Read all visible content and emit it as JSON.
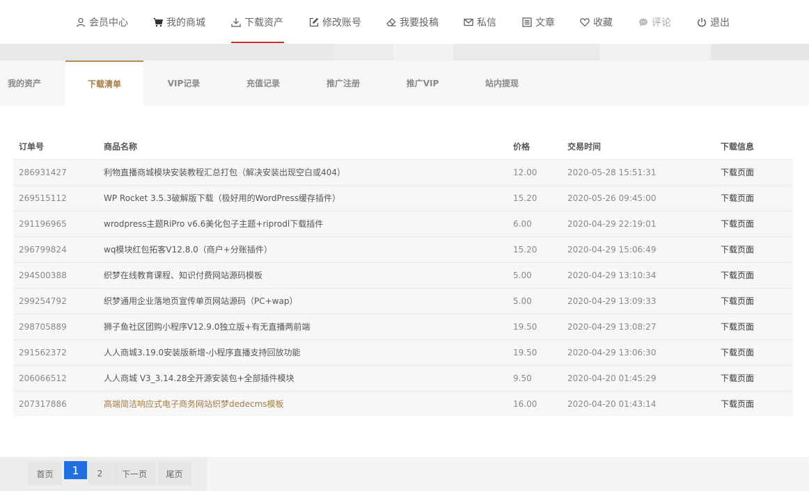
{
  "nav": {
    "items": [
      {
        "label": "会员中心",
        "icon": "user-icon"
      },
      {
        "label": "我的商城",
        "icon": "cart-icon"
      },
      {
        "label": "下载资产",
        "icon": "download-icon",
        "active": true
      },
      {
        "label": "修改账号",
        "icon": "edit-icon"
      },
      {
        "label": "我要投稿",
        "icon": "eraser-icon"
      },
      {
        "label": "私信",
        "icon": "mail-icon"
      },
      {
        "label": "文章",
        "icon": "list-icon"
      },
      {
        "label": "收藏",
        "icon": "heart-icon"
      },
      {
        "label": "评论",
        "icon": "comment-icon",
        "disabled": true
      },
      {
        "label": "退出",
        "icon": "power-icon"
      }
    ],
    "active_color": "#c9302c"
  },
  "subtabs": {
    "items": [
      "我的资产",
      "下载清单",
      "VIP记录",
      "充值记录",
      "推广注册",
      "推广VIP",
      "站内提现"
    ],
    "active_index": 1,
    "active_color": "#a27c44"
  },
  "table": {
    "headers": [
      "订单号",
      "商品名称",
      "价格",
      "交易时间",
      "下载信息"
    ],
    "rows": [
      [
        "286931427",
        "利物直播商城模块安装教程汇总打包（解决安装出现空白或404）",
        "12.00",
        "2020-05-28 15:51:31",
        "下载页面"
      ],
      [
        "269515112",
        "WP Rocket 3.5.3破解版下载（极好用的WordPress缓存插件）",
        "15.20",
        "2020-05-26 09:45:00",
        "下载页面"
      ],
      [
        "291196965",
        "wrodpress主题RiPro v6.6美化包子主题+riprodl下载插件",
        "6.00",
        "2020-04-29 22:19:01",
        "下载页面"
      ],
      [
        "296799824",
        "wq模块红包拓客V12.8.0（商户+分账插件）",
        "15.20",
        "2020-04-29 15:06:49",
        "下载页面"
      ],
      [
        "294500388",
        "织梦在线教育课程、知识付费网站源码模板",
        "5.00",
        "2020-04-29 13:10:34",
        "下载页面"
      ],
      [
        "299254792",
        "织梦通用企业落地页宣传单页网站源码（PC+wap）",
        "5.00",
        "2020-04-29 13:09:33",
        "下载页面"
      ],
      [
        "298705889",
        "狮子鱼社区团购小程序V12.9.0独立版+有无直播两前端",
        "19.50",
        "2020-04-29 13:08:27",
        "下载页面"
      ],
      [
        "291562372",
        "人人商城3.19.0安装版新增-小程序直播支持回放功能",
        "19.50",
        "2020-04-29 13:06:30",
        "下载页面"
      ],
      [
        "206066512",
        "人人商城 V3_3.14.28全开源安装包+全部插件模块",
        "9.50",
        "2020-04-20 01:45:29",
        "下载页面"
      ],
      [
        "207317886",
        "高端简洁响应式电子商务网站织梦dedecms模板",
        "16.00",
        "2020-04-20 01:43:14",
        "下载页面"
      ]
    ],
    "highlight_row": 9
  },
  "pager": {
    "first": "首页",
    "pages": [
      "1",
      "2"
    ],
    "current": "1",
    "next": "下一页",
    "last": "尾页",
    "current_color": "#1f6fe0"
  }
}
